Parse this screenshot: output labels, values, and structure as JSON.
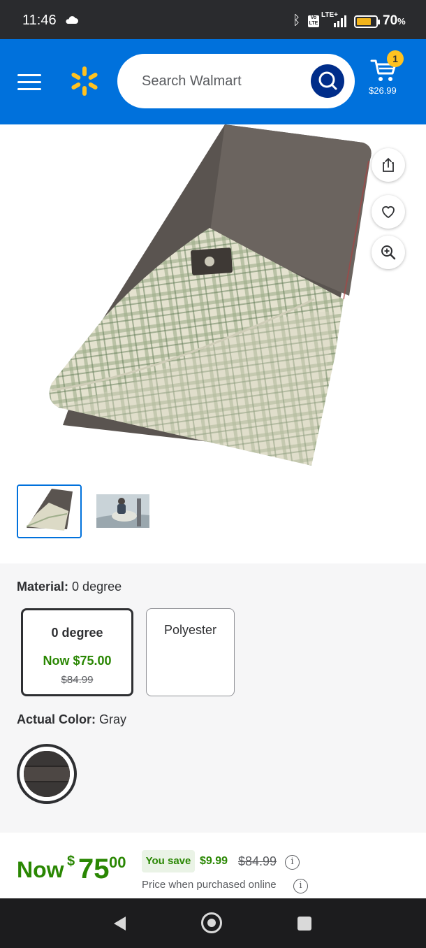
{
  "status_bar": {
    "time": "11:46",
    "volte": "Vo LTE",
    "network": "LTE+",
    "battery_percent": "70",
    "battery_unit": "%",
    "battery_level": 0.7
  },
  "header": {
    "search_placeholder": "Search Walmart",
    "cart_count": "1",
    "cart_total": "$26.99",
    "brand_color": "#0071dc",
    "spark_color": "#ffc220"
  },
  "gallery": {
    "thumbnails": [
      "sleeping-bag-product",
      "person-with-sleeping-bag"
    ],
    "selected_index": 0
  },
  "variants": {
    "material_label": "Material:",
    "material_value": "0 degree",
    "options": [
      {
        "name": "0 degree",
        "now_price": "Now $75.00",
        "was_price": "$84.99",
        "selected": true
      },
      {
        "name": "Polyester",
        "selected": false
      }
    ],
    "color_label": "Actual Color:",
    "color_value": "Gray"
  },
  "price": {
    "now_label": "Now",
    "currency": "$",
    "dollars": "75",
    "cents": "00",
    "you_save_label": "You save",
    "save_amount": "$9.99",
    "was_price": "$84.99",
    "note": "Price when purchased online",
    "green": "#2a8703"
  }
}
